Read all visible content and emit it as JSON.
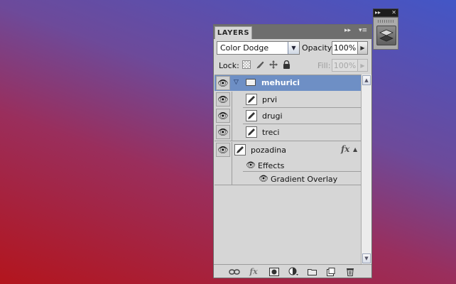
{
  "panel": {
    "tab_title": "LAYERS",
    "blend_mode": "Color Dodge",
    "opacity_label": "Opacity:",
    "opacity_value": "100%",
    "lock_label": "Lock:",
    "fill_label": "Fill:",
    "fill_value": "100%"
  },
  "layers": {
    "group": {
      "name": "mehurici",
      "expanded": true,
      "selected": true
    },
    "children": [
      {
        "name": "prvi"
      },
      {
        "name": "drugi"
      },
      {
        "name": "treci"
      }
    ],
    "background": {
      "name": "pozadina",
      "fx_badge": "fx",
      "effects_label": "Effects",
      "effects": [
        {
          "name": "Gradient Overlay"
        }
      ]
    }
  },
  "icons": {
    "visibility": "eye-icon",
    "group_folder": "folder-icon",
    "layer_thumb": "brush-icon",
    "mini_dock_layers": "layers-icon"
  },
  "colors": {
    "selected_row": "#6e8fc5",
    "panel_bg": "#d6d6d6",
    "tab_strip": "#6e6e6e"
  }
}
